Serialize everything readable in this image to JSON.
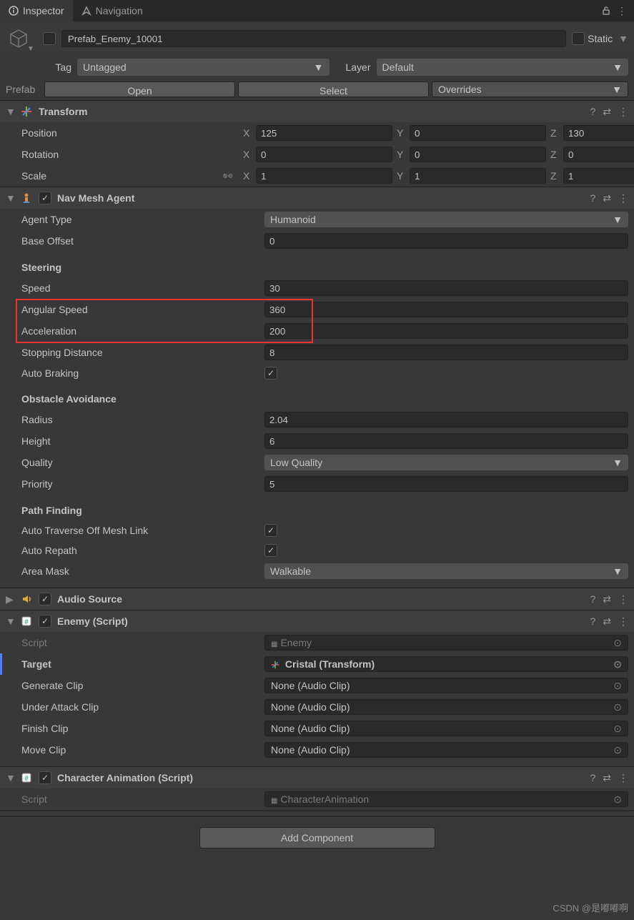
{
  "tabs": {
    "inspector": "Inspector",
    "navigation": "Navigation"
  },
  "header": {
    "name": "Prefab_Enemy_10001",
    "static_label": "Static"
  },
  "tag_layer": {
    "tag_label": "Tag",
    "tag_value": "Untagged",
    "layer_label": "Layer",
    "layer_value": "Default"
  },
  "prefab_bar": {
    "label": "Prefab",
    "open": "Open",
    "select": "Select",
    "overrides": "Overrides"
  },
  "transform": {
    "title": "Transform",
    "position_label": "Position",
    "position": {
      "x": "125",
      "y": "0",
      "z": "130"
    },
    "rotation_label": "Rotation",
    "rotation": {
      "x": "0",
      "y": "0",
      "z": "0"
    },
    "scale_label": "Scale",
    "scale": {
      "x": "1",
      "y": "1",
      "z": "1"
    }
  },
  "navmesh": {
    "title": "Nav Mesh Agent",
    "agent_type_label": "Agent Type",
    "agent_type": "Humanoid",
    "base_offset_label": "Base Offset",
    "base_offset": "0",
    "steering_header": "Steering",
    "speed_label": "Speed",
    "speed": "30",
    "angular_speed_label": "Angular Speed",
    "angular_speed": "360",
    "acceleration_label": "Acceleration",
    "acceleration": "200",
    "stopping_distance_label": "Stopping Distance",
    "stopping_distance": "8",
    "auto_braking_label": "Auto Braking",
    "obstacle_header": "Obstacle Avoidance",
    "radius_label": "Radius",
    "radius": "2.04",
    "height_label": "Height",
    "height": "6",
    "quality_label": "Quality",
    "quality": "Low Quality",
    "priority_label": "Priority",
    "priority": "5",
    "pathfinding_header": "Path Finding",
    "auto_traverse_label": "Auto Traverse Off Mesh Link",
    "auto_repath_label": "Auto Repath",
    "area_mask_label": "Area Mask",
    "area_mask": "Walkable"
  },
  "audio": {
    "title": "Audio Source"
  },
  "enemy": {
    "title": "Enemy (Script)",
    "script_label": "Script",
    "script_value": "Enemy",
    "target_label": "Target",
    "target_value": "Cristal (Transform)",
    "generate_clip_label": "Generate Clip",
    "generate_clip_value": "None (Audio Clip)",
    "under_attack_label": "Under Attack Clip",
    "under_attack_value": "None (Audio Clip)",
    "finish_clip_label": "Finish Clip",
    "finish_clip_value": "None (Audio Clip)",
    "move_clip_label": "Move Clip",
    "move_clip_value": "None (Audio Clip)"
  },
  "char_anim": {
    "title": "Character Animation (Script)",
    "script_label": "Script",
    "script_value": "CharacterAnimation"
  },
  "add_component": "Add Component",
  "axis": {
    "x": "X",
    "y": "Y",
    "z": "Z"
  },
  "watermark": "CSDN @是嘟嘟啊"
}
